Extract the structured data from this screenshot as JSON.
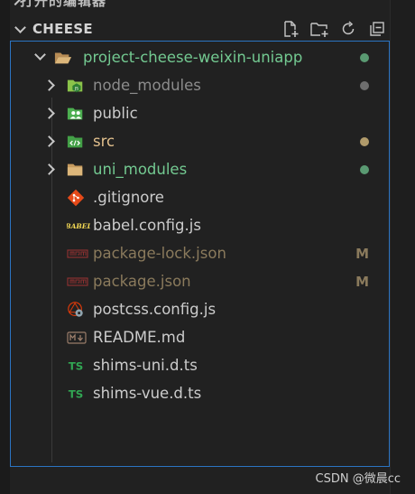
{
  "top_partial_title": "打开的编辑器",
  "section": {
    "title": "CHEESE"
  },
  "actions": [
    {
      "name": "new-file-icon"
    },
    {
      "name": "new-folder-icon"
    },
    {
      "name": "refresh-icon"
    },
    {
      "name": "collapse-all-icon"
    }
  ],
  "tree": {
    "root": {
      "label": "project-cheese-weixin-uniapp",
      "color": "#73c991"
    },
    "items": [
      {
        "label": "node_modules",
        "type": "folder",
        "icon": "node-modules-folder-icon",
        "color": "#8c8c8c",
        "decoration": "dot",
        "dot_color": "#6e6e6e"
      },
      {
        "label": "public",
        "type": "folder",
        "icon": "public-folder-icon",
        "color": "#cccccc"
      },
      {
        "label": "src",
        "type": "folder",
        "icon": "src-folder-icon",
        "color": "#e2c08d",
        "decoration": "dot",
        "dot_color": "#b19b6b"
      },
      {
        "label": "uni_modules",
        "type": "folder",
        "icon": "folder-icon",
        "color": "#73c991",
        "decoration": "dot",
        "dot_color": "#5a9a72"
      },
      {
        "label": ".gitignore",
        "type": "file",
        "icon": "git-icon",
        "color": "#cccccc"
      },
      {
        "label": "babel.config.js",
        "type": "file",
        "icon": "babel-icon",
        "color": "#cccccc"
      },
      {
        "label": "package-lock.json",
        "type": "file",
        "icon": "npm-icon",
        "color": "#8a7a5c",
        "decoration_text": "M",
        "deco_color": "#8a7a5c"
      },
      {
        "label": "package.json",
        "type": "file",
        "icon": "npm-icon",
        "color": "#8a7a5c",
        "decoration_text": "M",
        "deco_color": "#8a7a5c"
      },
      {
        "label": "postcss.config.js",
        "type": "file",
        "icon": "postcss-icon",
        "color": "#cccccc"
      },
      {
        "label": "README.md",
        "type": "file",
        "icon": "markdown-icon",
        "color": "#cccccc"
      },
      {
        "label": "shims-uni.d.ts",
        "type": "file",
        "icon": "typescript-icon",
        "color": "#cccccc"
      },
      {
        "label": "shims-vue.d.ts",
        "type": "file",
        "icon": "typescript-icon",
        "color": "#cccccc"
      }
    ]
  },
  "watermark": "CSDN @微晨cc"
}
